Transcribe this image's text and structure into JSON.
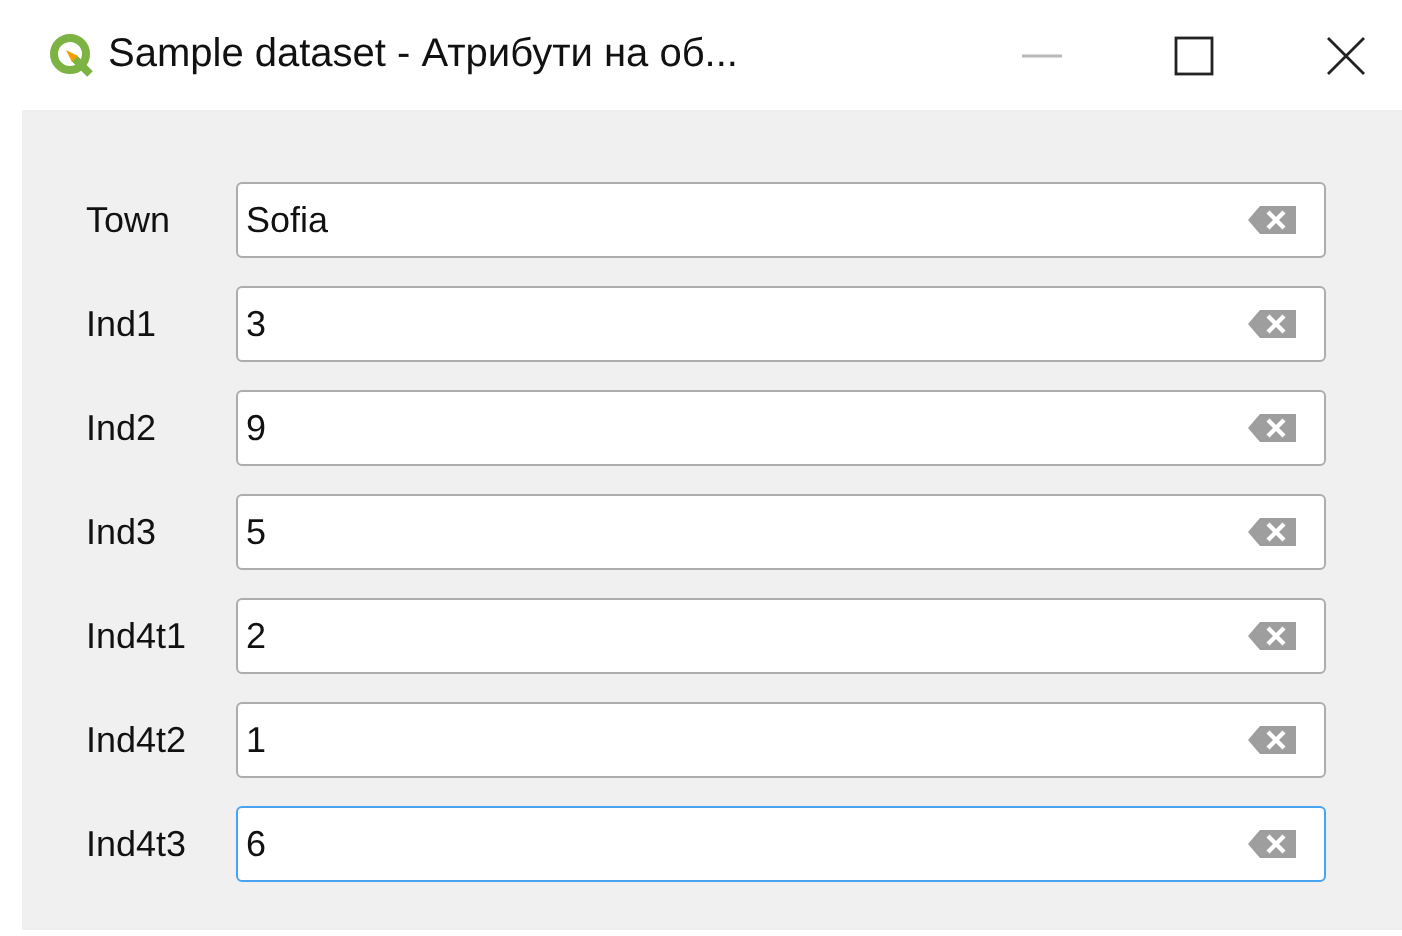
{
  "window": {
    "title": "Sample dataset - Атрибути на об..."
  },
  "fields": [
    {
      "label": "Town",
      "value": "Sofia",
      "focused": false
    },
    {
      "label": "Ind1",
      "value": "3",
      "focused": false
    },
    {
      "label": "Ind2",
      "value": "9",
      "focused": false
    },
    {
      "label": "Ind3",
      "value": "5",
      "focused": false
    },
    {
      "label": "Ind4t1",
      "value": "2",
      "focused": false
    },
    {
      "label": "Ind4t2",
      "value": "1",
      "focused": false
    },
    {
      "label": "Ind4t3",
      "value": "6",
      "focused": true
    }
  ]
}
